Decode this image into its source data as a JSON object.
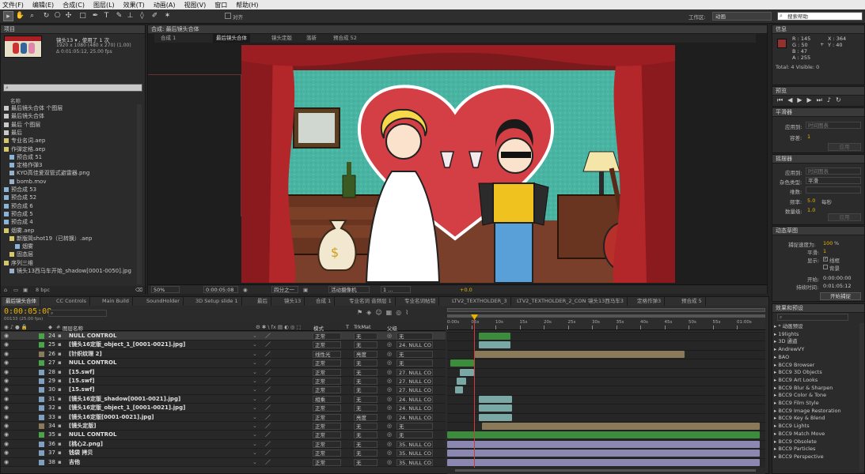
{
  "menu": [
    "文件(F)",
    "编辑(E)",
    "合成(C)",
    "图层(L)",
    "效果(T)",
    "动画(A)",
    "视图(V)",
    "窗口",
    "帮助(H)"
  ],
  "toolbar": {
    "align_label": "对齐",
    "workspace_label": "工作区:",
    "workspace_value": "动画",
    "search_placeholder": "搜索帮助"
  },
  "project": {
    "panel_title": "项目",
    "thumb_name": "镜头13 ▾ , 使用了 1 次",
    "thumb_res": "1920 x 1080 (480 x 270) (1.00)",
    "thumb_dur": "Δ 0:01:05:12, 25.00 fps",
    "search_placeholder": "",
    "col_name": "名称",
    "bpc": "8 bpc",
    "items": [
      {
        "label": "最后镜头合体 个图层",
        "color": "#c9c9c9",
        "indent": 0
      },
      {
        "label": "最后镜头合体",
        "color": "#c9c9c9",
        "indent": 0
      },
      {
        "label": "最后 个图层",
        "color": "#c9c9c9",
        "indent": 0
      },
      {
        "label": "最后",
        "color": "#c9c9c9",
        "indent": 0
      },
      {
        "label": "专业名词.aep",
        "color": "#d6c86a",
        "indent": 0
      },
      {
        "label": "作弹定格.aep",
        "color": "#d6c86a",
        "indent": 0
      },
      {
        "label": "预合成 51",
        "color": "#8ab4d8",
        "indent": 1
      },
      {
        "label": "定格作弹3",
        "color": "#8ab4d8",
        "indent": 1
      },
      {
        "label": "KYO高佳爱双管式避雷器.png",
        "color": "#9ab0c8",
        "indent": 1
      },
      {
        "label": "bomb.mov",
        "color": "#9ab0c8",
        "indent": 1
      },
      {
        "label": "预合成 53",
        "color": "#8ab4d8",
        "indent": 0
      },
      {
        "label": "预合成 52",
        "color": "#8ab4d8",
        "indent": 0
      },
      {
        "label": "预合成 6",
        "color": "#8ab4d8",
        "indent": 0
      },
      {
        "label": "预合成 5",
        "color": "#8ab4d8",
        "indent": 0
      },
      {
        "label": "预合成 4",
        "color": "#8ab4d8",
        "indent": 0
      },
      {
        "label": "烟雾.aep",
        "color": "#d6c86a",
        "indent": 0
      },
      {
        "label": "新版简shot19（已转换）.aep",
        "color": "#d6c86a",
        "indent": 1
      },
      {
        "label": "烟雾",
        "color": "#8ab4d8",
        "indent": 2
      },
      {
        "label": "固态层",
        "color": "#d6c86a",
        "indent": 1
      },
      {
        "label": "序列三维",
        "color": "#d6c86a",
        "indent": 0
      },
      {
        "label": "镜头13西马车开始_shadow[0001-0050].jpg",
        "color": "#9ab0c8",
        "indent": 1
      }
    ]
  },
  "comp": {
    "panel_title": "合成: 最后镜头合体",
    "breadcrumbs": [
      "合成 1",
      "最后镜头合体",
      "镜头定版",
      "落新",
      "预合成 52"
    ],
    "zoom": "50%",
    "timecode": "0:00:05:08",
    "quality": "四分之一",
    "camera": "活动摄像机",
    "views": "1 ...",
    "exposure": "+0.0"
  },
  "info": {
    "title": "信息",
    "r": "R : 145",
    "g": "G : 50",
    "b": "B : 47",
    "a": "A : 255",
    "x": "X : 364",
    "y": "Y : 40",
    "total": "Total: 4  Visible: 0",
    "swatch": "#91322f"
  },
  "preview": {
    "title": "预览"
  },
  "smoother": {
    "title": "平滑器",
    "apply_label": "应用到:",
    "apply_value": "时间图表",
    "tolerance_label": "容差:",
    "tolerance_value": "1",
    "button": "应用"
  },
  "wiggler": {
    "title": "摇摆器",
    "apply_label": "应用到:",
    "apply_value": "时间图表",
    "noise_label": "杂色类型:",
    "noise_value": "平滑",
    "dim_label": "维数:",
    "freq_label": "频率:",
    "freq_value": "5.0",
    "freq_unit": "每秒",
    "mag_label": "数量级:",
    "mag_value": "1.0",
    "button": "应用"
  },
  "motion_sketch": {
    "title": "动态草图",
    "speed_label": "捕捉速度为:",
    "speed_value": "100",
    "speed_unit": "%",
    "smooth_label": "平滑:",
    "smooth_value": "1",
    "show_label": "显示:",
    "wire_label": "线框",
    "bg_label": "背景",
    "start_label": "开始:",
    "start_value": "0:00:00:00",
    "dur_label": "持续时间:",
    "dur_value": "0:01:05:12",
    "button": "开始捕捉"
  },
  "effects": {
    "title": "效果和预设",
    "search_placeholder": "",
    "items": [
      "* 动画预设",
      "19lights",
      "3D 通道",
      "AndrewVY",
      "BAO",
      "BCC9 Browser",
      "BCC9 3D Objects",
      "BCC9 Art Looks",
      "BCC9 Blur & Sharpen",
      "BCC9 Color & Tone",
      "BCC9 Film Style",
      "BCC9 Image Restoration",
      "BCC9 Key & Blend",
      "BCC9 Lights",
      "BCC9 Match Move",
      "BCC9 Obsolete",
      "BCC9 Particles",
      "BCC9 Perspective"
    ]
  },
  "timeline": {
    "tabs": [
      "最后镜头合体",
      "CC Controls",
      "Main Build",
      "SoundHolder",
      "3D Setup slide 1",
      "最后",
      "镜头13",
      "合成 1",
      "专业名词 音频层 1",
      "专业名词帖韧",
      "LTV2_TEXTHOLDER_3",
      "LTV2_TEXTHOLDER_2_CON",
      "镜头13西马车3",
      "定格作弹3",
      "预合成 5"
    ],
    "timecode": "0:00:05:08",
    "frames": "00133 (25.00 fps)",
    "col_layer": "图层名称",
    "col_mode": "模式",
    "col_t": "T",
    "col_trkmat": "TrkMat",
    "col_parent": "父级",
    "ruler": [
      "0:00s",
      "05s",
      "10s",
      "15s",
      "20s",
      "25s",
      "30s",
      "35s",
      "40s",
      "45s",
      "50s",
      "55s",
      "01:00s"
    ],
    "layers": [
      {
        "num": "24",
        "name": "NULL CONTROL",
        "color": "#49a44a",
        "mode": "正常",
        "trk": "无",
        "parent": "无",
        "bar_color": "#3d8c3d",
        "bar_start": 40,
        "bar_end": 80
      },
      {
        "num": "25",
        "name": "[镜头16定版_object_1_[0001-0021].jpg]",
        "color": "#49a44a",
        "mode": "正常",
        "trk": "无",
        "parent": "24. NULL CO",
        "bar_color": "#7aa8a4",
        "bar_start": 40,
        "bar_end": 80
      },
      {
        "num": "26",
        "name": "[针织纹理 2]",
        "color": "#8a7a5a",
        "mode": "线性光",
        "trk": "亮度",
        "parent": "无",
        "bar_color": "#8a7a5a",
        "bar_start": 35,
        "bar_end": 300
      },
      {
        "num": "27",
        "name": "NULL CONTROL",
        "color": "#49a44a",
        "mode": "正常",
        "trk": "无",
        "parent": "无",
        "bar_color": "#3d8c3d",
        "bar_start": 4,
        "bar_end": 34
      },
      {
        "num": "28",
        "name": "[15.swf]",
        "color": "#7fa0c0",
        "mode": "正常",
        "trk": "无",
        "parent": "27. NULL CO",
        "bar_color": "#7aa8a4",
        "bar_start": 16,
        "bar_end": 34
      },
      {
        "num": "29",
        "name": "[15.swf]",
        "color": "#7fa0c0",
        "mode": "正常",
        "trk": "无",
        "parent": "27. NULL CO",
        "bar_color": "#7aa8a4",
        "bar_start": 12,
        "bar_end": 24
      },
      {
        "num": "30",
        "name": "[15.swf]",
        "color": "#7fa0c0",
        "mode": "正常",
        "trk": "无",
        "parent": "27. NULL CO",
        "bar_color": "#7aa8a4",
        "bar_start": 10,
        "bar_end": 20
      },
      {
        "num": "31",
        "name": "[镜头16定版_shadow[0001-0021].jpg]",
        "color": "#7fa0c0",
        "mode": "相乘",
        "trk": "无",
        "parent": "24. NULL CO",
        "bar_color": "#7aa8a4",
        "bar_start": 40,
        "bar_end": 82
      },
      {
        "num": "32",
        "name": "[镜头16定版_object_1_[0001-0021].jpg]",
        "color": "#7fa0c0",
        "mode": "正常",
        "trk": "无",
        "parent": "24. NULL CO",
        "bar_color": "#7aa8a4",
        "bar_start": 40,
        "bar_end": 82
      },
      {
        "num": "33",
        "name": "[镜头16定版[0001-0021].jpg]",
        "color": "#7fa0c0",
        "mode": "正常",
        "trk": "亮度",
        "parent": "24. NULL CO",
        "bar_color": "#7aa8a4",
        "bar_start": 40,
        "bar_end": 82
      },
      {
        "num": "34",
        "name": "[镜头定版]",
        "color": "#8a7a5a",
        "mode": "正常",
        "trk": "无",
        "parent": "无",
        "bar_color": "#8a7a5a",
        "bar_start": 44,
        "bar_end": 395
      },
      {
        "num": "35",
        "name": "NULL CONTROL",
        "color": "#49a44a",
        "mode": "正常",
        "trk": "无",
        "parent": "无",
        "bar_color": "#3d8c3d",
        "bar_start": 0,
        "bar_end": 395
      },
      {
        "num": "36",
        "name": "[桃心2.png]",
        "color": "#7fa0c0",
        "mode": "正常",
        "trk": "无",
        "parent": "35. NULL CO",
        "bar_color": "#8a88b0",
        "bar_start": 0,
        "bar_end": 395
      },
      {
        "num": "37",
        "name": "钱袋 拷贝",
        "color": "#7fa0c0",
        "mode": "正常",
        "trk": "无",
        "parent": "35. NULL CO",
        "bar_color": "#8a88b0",
        "bar_start": 0,
        "bar_end": 395
      },
      {
        "num": "38",
        "name": "吉他",
        "color": "#7fa0c0",
        "mode": "正常",
        "trk": "无",
        "parent": "35. NULL CO",
        "bar_color": "#8a88b0",
        "bar_start": 0,
        "bar_end": 395
      }
    ]
  },
  "colors": {
    "accent": "#e8b400",
    "playhead": "#d43a3a",
    "menubar": "#e9e9e9",
    "panel": "#2b2b2b"
  }
}
